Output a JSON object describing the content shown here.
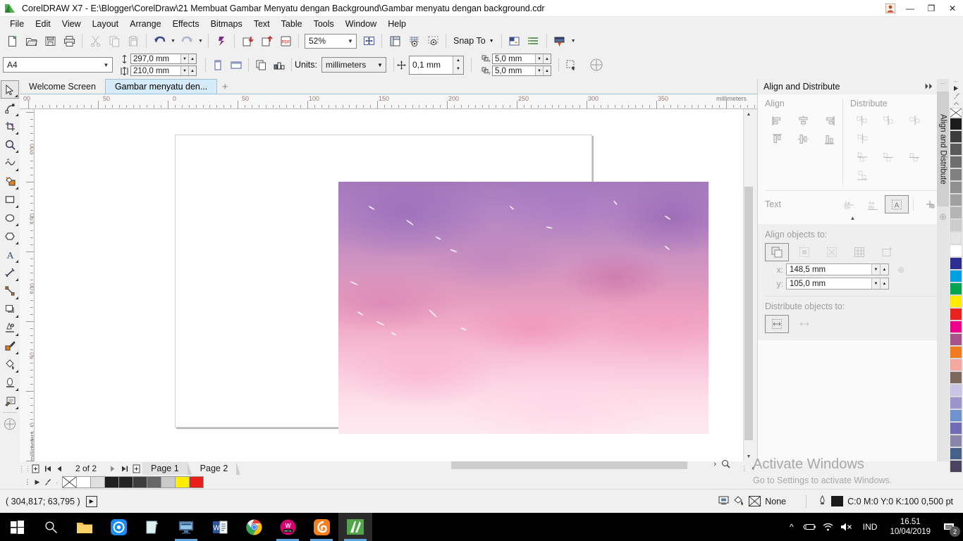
{
  "titlebar": {
    "title": "CorelDRAW X7 - E:\\Blogger\\CorelDraw\\21 Membuat Gambar Menyatu dengan Background\\Gambar menyatu dengan background.cdr",
    "minimize": "—",
    "restore": "❐",
    "close": "✕"
  },
  "menu": [
    {
      "label": "File"
    },
    {
      "label": "Edit"
    },
    {
      "label": "View"
    },
    {
      "label": "Layout"
    },
    {
      "label": "Arrange"
    },
    {
      "label": "Effects"
    },
    {
      "label": "Bitmaps"
    },
    {
      "label": "Text"
    },
    {
      "label": "Table"
    },
    {
      "label": "Tools"
    },
    {
      "label": "Window"
    },
    {
      "label": "Help"
    }
  ],
  "standard_toolbar": {
    "zoom_level": "52%",
    "snap_to_label": "Snap To",
    "buttons": [
      {
        "name": "new-document",
        "title": "New"
      },
      {
        "name": "open-document",
        "title": "Open"
      },
      {
        "name": "save-document",
        "title": "Save"
      },
      {
        "name": "print-document",
        "title": "Print"
      },
      {
        "name": "cut",
        "title": "Cut"
      },
      {
        "name": "copy",
        "title": "Copy"
      },
      {
        "name": "paste",
        "title": "Paste"
      },
      {
        "name": "undo",
        "title": "Undo"
      },
      {
        "name": "redo",
        "title": "Redo"
      },
      {
        "name": "search-content",
        "title": "Search Content"
      },
      {
        "name": "import",
        "title": "Import"
      },
      {
        "name": "export",
        "title": "Export"
      },
      {
        "name": "publish-pdf",
        "title": "Publish to PDF"
      },
      {
        "name": "zoom-levels",
        "title": "Zoom Levels"
      },
      {
        "name": "full-screen-preview",
        "title": "Full-Screen Preview"
      },
      {
        "name": "show-rulers",
        "title": "Show Rulers"
      },
      {
        "name": "show-grid",
        "title": "Show Grid"
      },
      {
        "name": "show-guidelines",
        "title": "Show Guidelines"
      },
      {
        "name": "options",
        "title": "Options"
      },
      {
        "name": "object-manager",
        "title": "Object Manager"
      },
      {
        "name": "application-launcher",
        "title": "Application Launcher"
      }
    ]
  },
  "property_bar": {
    "page_size": "A4",
    "page_width": "297,0 mm",
    "page_height": "210,0 mm",
    "units_label": "Units:",
    "units_value": "millimeters",
    "nudge_offset": "0,1 mm",
    "duplicate_x": "5,0 mm",
    "duplicate_y": "5,0 mm",
    "orientation_portrait": "portrait",
    "orientation_landscape": "landscape"
  },
  "document_tabs": {
    "tabs": [
      {
        "label": "Welcome Screen",
        "active": false
      },
      {
        "label": "Gambar menyatu den...",
        "active": true
      }
    ],
    "add_label": "+"
  },
  "toolbox": [
    {
      "name": "pick-tool",
      "selected": true
    },
    {
      "name": "shape-tool",
      "selected": false
    },
    {
      "name": "crop-tool",
      "selected": false
    },
    {
      "name": "zoom-tool",
      "selected": false
    },
    {
      "name": "freehand-tool",
      "selected": false
    },
    {
      "name": "smart-fill-tool",
      "selected": false
    },
    {
      "name": "rectangle-tool",
      "selected": false
    },
    {
      "name": "ellipse-tool",
      "selected": false
    },
    {
      "name": "polygon-tool",
      "selected": false
    },
    {
      "name": "text-tool",
      "selected": false
    },
    {
      "name": "parallel-dimension-tool",
      "selected": false
    },
    {
      "name": "straight-line-connector-tool",
      "selected": false
    },
    {
      "name": "drop-shadow-tool",
      "selected": false
    },
    {
      "name": "transparency-tool",
      "selected": false
    },
    {
      "name": "color-eyedropper-tool",
      "selected": false
    },
    {
      "name": "interactive-fill-tool",
      "selected": false
    },
    {
      "name": "mesh-fill-tool",
      "selected": false
    },
    {
      "name": "smart-drawing-tool",
      "selected": false
    },
    {
      "name": "quick-customize",
      "selected": false
    }
  ],
  "rulers": {
    "unit_label": "millimeters",
    "h_labels": [
      "00",
      "50",
      "0",
      "50",
      "100",
      "150",
      "200",
      "250",
      "300",
      "350"
    ],
    "v_labels": [
      "200",
      "150",
      "100",
      "50",
      "0"
    ],
    "v_unit_label": "millimeters"
  },
  "docker": {
    "title": "Align and Distribute",
    "collapse_icon": "⏵⏵",
    "close_icon": "✕",
    "align_label": "Align",
    "distribute_label": "Distribute",
    "text_label": "Text",
    "align_objects_to_label": "Align objects to:",
    "distribute_objects_to_label": "Distribute objects to:",
    "x_label": "x:",
    "y_label": "y:",
    "x_value": "148,5 mm",
    "y_value": "105,0 mm",
    "tab_label": "Align and Distribute",
    "align_buttons": [
      {
        "name": "align-left"
      },
      {
        "name": "align-center-horizontally"
      },
      {
        "name": "align-right"
      },
      {
        "name": "align-top"
      },
      {
        "name": "align-center-vertically"
      },
      {
        "name": "align-bottom"
      }
    ],
    "distribute_buttons": [
      {
        "name": "distribute-left"
      },
      {
        "name": "distribute-center-horizontally"
      },
      {
        "name": "distribute-spacing-horizontally"
      },
      {
        "name": "distribute-right"
      },
      {
        "name": "distribute-top"
      },
      {
        "name": "distribute-center-vertically"
      },
      {
        "name": "distribute-spacing-vertically"
      },
      {
        "name": "distribute-bottom"
      }
    ],
    "text_buttons": [
      {
        "name": "text-first-line-baseline"
      },
      {
        "name": "text-last-line-baseline"
      },
      {
        "name": "text-bounding-box",
        "active": true
      },
      {
        "name": "outline-align"
      }
    ],
    "align_targets": [
      {
        "name": "active-objects",
        "active": true
      },
      {
        "name": "edge-of-page"
      },
      {
        "name": "center-of-page"
      },
      {
        "name": "grid"
      },
      {
        "name": "specified-point"
      }
    ],
    "distribute_targets": [
      {
        "name": "extent-of-selection",
        "active": true
      },
      {
        "name": "extent-of-page"
      }
    ]
  },
  "canvas": {
    "page_label": "document page",
    "artwork_name": "watercolor pink purple background bitmap"
  },
  "palette": {
    "name": "default-color-palette",
    "colors": [
      "#1c1c1c",
      "#3d3d3d",
      "#5a5a5a",
      "#6e6e6e",
      "#808080",
      "#909090",
      "#a1a1a1",
      "#b4b4b4",
      "#cccccc",
      "#e4e4e4",
      "#ffffff",
      "#2b2f91",
      "#00a0e3",
      "#00a551",
      "#ffec00",
      "#e8221c",
      "#ec008c",
      "#a8528c",
      "#f07c1e",
      "#f4a8a0",
      "#7d675f",
      "#c8c4e4",
      "#9b95cc",
      "#6e93cf",
      "#6f6bb5",
      "#8a86ab",
      "#456089",
      "#4a425f"
    ]
  },
  "page_navigator": {
    "add_page_before": "add page before",
    "first_page": "first page",
    "prev_page": "previous page",
    "page_count": "2 of 2",
    "next_page": "next page",
    "last_page": "last page",
    "add_page_after": "add page after",
    "pages": [
      {
        "label": "Page 1",
        "active": true
      },
      {
        "label": "Page 2",
        "active": false
      }
    ]
  },
  "color_bar": {
    "swatches": [
      "none",
      "#ffffff",
      "#e0e0e0",
      "#1e1e1e",
      "#232323",
      "#3c3c3c",
      "#666666",
      "#c9c9c9",
      "#ffed00",
      "#e8201c"
    ]
  },
  "statusbar": {
    "coordinates": "( 304,817; 63,795 )",
    "fill_value": "None",
    "outline_value": "C:0 M:0 Y:0 K:100  0,500 pt",
    "outline_swatch": "#1a1a1a"
  },
  "watermark": {
    "line1": "Activate Windows",
    "line2": "Go to Settings to activate Windows."
  },
  "taskbar": {
    "items": [
      {
        "name": "start-button",
        "running": false
      },
      {
        "name": "search-icon",
        "running": false
      },
      {
        "name": "file-explorer",
        "running": false
      },
      {
        "name": "shareit-app",
        "running": false
      },
      {
        "name": "sticky-notes",
        "running": false
      },
      {
        "name": "remote-desktop",
        "running": true
      },
      {
        "name": "microsoft-word",
        "running": false
      },
      {
        "name": "google-chrome",
        "running": true
      },
      {
        "name": "wattpad-beta",
        "running": true
      },
      {
        "name": "uc-browser",
        "running": true
      },
      {
        "name": "coreldraw",
        "running": true,
        "active": true
      }
    ],
    "tray": {
      "show_hidden": "^",
      "battery": "battery-icon",
      "network": "wifi-icon",
      "volume": "volume-muted-icon",
      "language": "IND",
      "time": "16.51",
      "date": "10/04/2019",
      "notifications_count": "2"
    }
  }
}
